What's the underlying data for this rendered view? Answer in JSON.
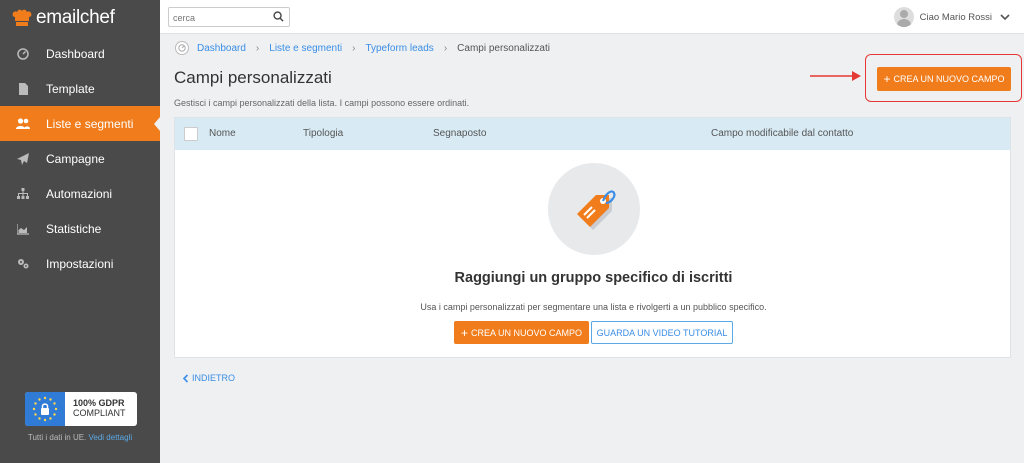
{
  "brand": {
    "name": "emailchef",
    "accent": "#f07c1b"
  },
  "sidebar": {
    "items": [
      {
        "label": "Dashboard",
        "icon": "gauge-icon"
      },
      {
        "label": "Template",
        "icon": "document-icon"
      },
      {
        "label": "Liste e segmenti",
        "icon": "users-icon",
        "active": true
      },
      {
        "label": "Campagne",
        "icon": "paper-plane-icon"
      },
      {
        "label": "Automazioni",
        "icon": "hierarchy-icon"
      },
      {
        "label": "Statistiche",
        "icon": "area-chart-icon"
      },
      {
        "label": "Impostazioni",
        "icon": "gears-icon"
      }
    ],
    "gdpr": {
      "title": "100% GDPR",
      "subtitle": "COMPLIANT",
      "note": "Tutti i dati in UE.",
      "link": "Vedi dettagli"
    }
  },
  "topbar": {
    "search_placeholder": "cerca",
    "user_greeting": "Ciao Mario Rossi"
  },
  "breadcrumb": [
    "Dashboard",
    "Liste e segmenti",
    "Typeform leads",
    "Campi personalizzati"
  ],
  "page": {
    "title": "Campi personalizzati",
    "subtitle": "Gestisci i campi personalizzati della lista. I campi possono essere ordinati.",
    "create_button": "CREA UN NUOVO CAMPO"
  },
  "table": {
    "columns": [
      "Nome",
      "Tipologia",
      "Segnaposto",
      "Campo modificabile dal contatto"
    ]
  },
  "empty_state": {
    "icon": "tag-icon",
    "title": "Raggiungi un gruppo specifico di iscritti",
    "description": "Usa i campi personalizzati per segmentare una lista e rivolgerti a un pubblico specifico.",
    "primary_button": "CREA UN NUOVO CAMPO",
    "secondary_button": "GUARDA UN VIDEO TUTORIAL"
  },
  "footer": {
    "back_label": "INDIETRO"
  }
}
